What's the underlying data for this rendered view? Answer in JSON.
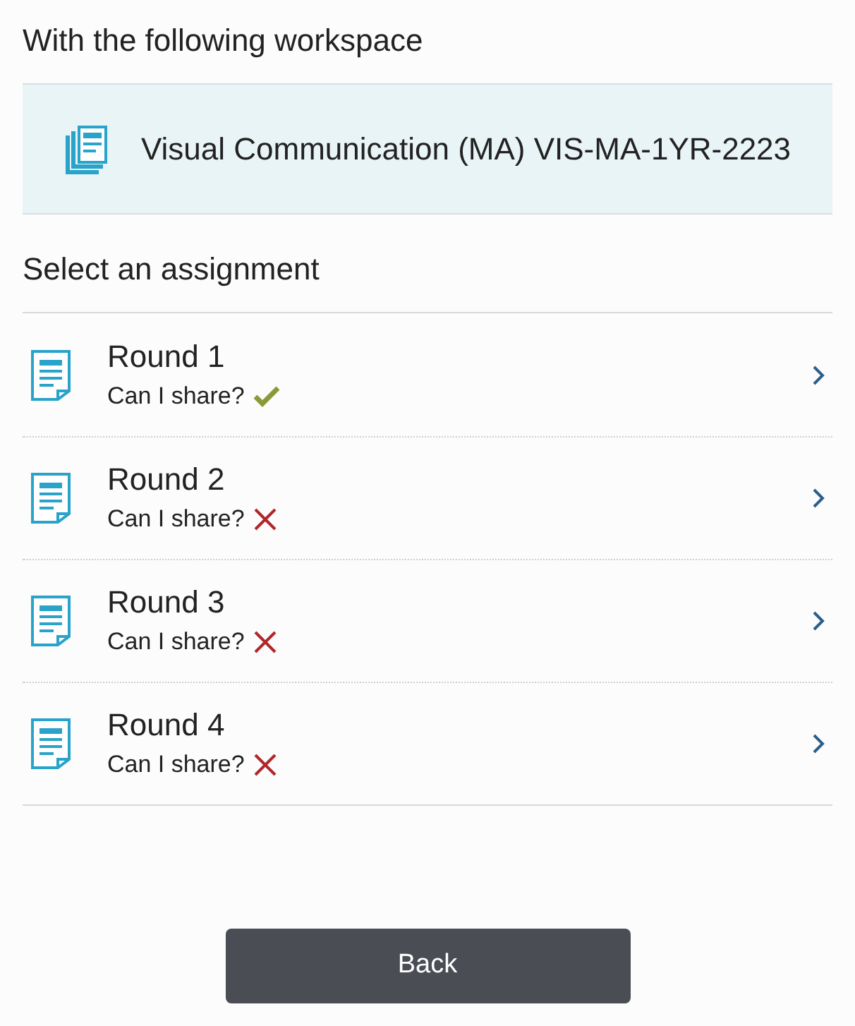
{
  "heading": "With the following workspace",
  "workspace": {
    "name": "Visual Communication (MA) VIS-MA-1YR-2223"
  },
  "subheading": "Select an assignment",
  "assignments": [
    {
      "title": "Round 1",
      "share_label": "Can I share?",
      "shareable": true
    },
    {
      "title": "Round 2",
      "share_label": "Can I share?",
      "shareable": false
    },
    {
      "title": "Round 3",
      "share_label": "Can I share?",
      "shareable": false
    },
    {
      "title": "Round 4",
      "share_label": "Can I share?",
      "shareable": false
    }
  ],
  "back_button": "Back"
}
